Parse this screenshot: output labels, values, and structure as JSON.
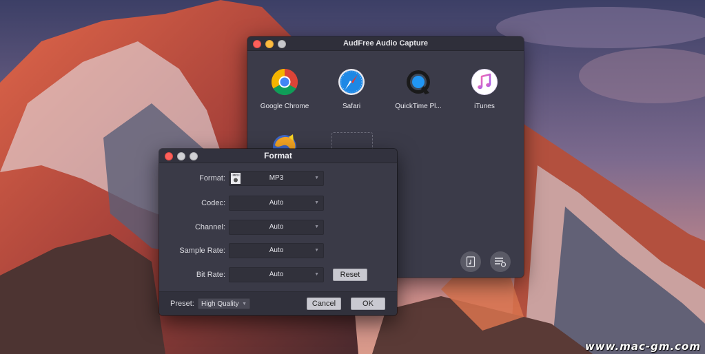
{
  "main_window": {
    "title": "AudFree Audio Capture",
    "apps": [
      {
        "label": "Google Chrome",
        "icon": "chrome-icon"
      },
      {
        "label": "Safari",
        "icon": "safari-icon"
      },
      {
        "label": "QuickTime Pl...",
        "icon": "quicktime-icon"
      },
      {
        "label": "iTunes",
        "icon": "itunes-icon"
      }
    ],
    "partial_app_icon": "firefox-icon",
    "bottom_buttons": [
      {
        "icon": "audio-file-icon"
      },
      {
        "icon": "capture-list-icon"
      }
    ]
  },
  "format_dialog": {
    "title": "Format",
    "rows": [
      {
        "label": "Format:",
        "value": "MP3",
        "badge": "MP3"
      },
      {
        "label": "Codec:",
        "value": "Auto"
      },
      {
        "label": "Channel:",
        "value": "Auto"
      },
      {
        "label": "Sample Rate:",
        "value": "Auto"
      },
      {
        "label": "Bit Rate:",
        "value": "Auto"
      }
    ],
    "reset_label": "Reset",
    "preset_label": "Preset:",
    "preset_value": "High Quality",
    "cancel_label": "Cancel",
    "ok_label": "OK"
  },
  "watermark": "www.mac-gm.com",
  "colors": {
    "window_bg": "#3b3b49",
    "traffic_red": "#fc605b",
    "traffic_yellow": "#fdbc40"
  }
}
